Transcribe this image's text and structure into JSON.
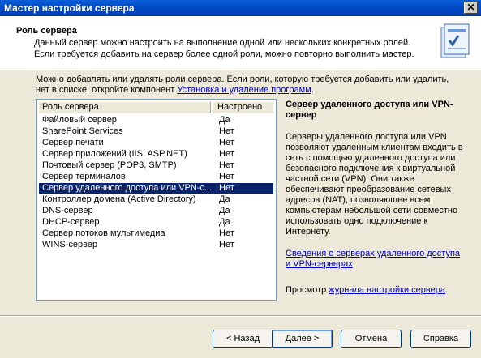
{
  "window": {
    "title": "Мастер настройки сервера",
    "close_label": "✕"
  },
  "header": {
    "title": "Роль сервера",
    "description_line1": "Данный сервер можно настроить на выполнение одной или нескольких конкретных ролей.",
    "description_line2": "Если требуется добавить на сервер более одной роли, можно повторно выполнить мастер.",
    "icon": "server-wizard-icon"
  },
  "intro": {
    "line1": "Можно добавлять или удалять роли сервера. Если роли, которую требуется добавить или удалить,",
    "line2_prefix": "нет в списке, откройте компонент ",
    "link": "Установка и удаление программ",
    "line2_suffix": "."
  },
  "list": {
    "col_role": "Роль сервера",
    "col_configured": "Настроено",
    "rows": [
      {
        "role": "Файловый сервер",
        "configured": "Да"
      },
      {
        "role": "SharePoint Services",
        "configured": "Нет"
      },
      {
        "role": "Сервер печати",
        "configured": "Нет"
      },
      {
        "role": "Сервер приложений (IIS, ASP.NET)",
        "configured": "Нет"
      },
      {
        "role": "Почтовый сервер (POP3, SMTP)",
        "configured": "Нет"
      },
      {
        "role": "Сервер терминалов",
        "configured": "Нет"
      },
      {
        "role": "Сервер удаленного доступа или VPN-с...",
        "configured": "Нет"
      },
      {
        "role": "Контроллер домена (Active Directory)",
        "configured": "Да"
      },
      {
        "role": "DNS-сервер",
        "configured": "Да"
      },
      {
        "role": "DHCP-сервер",
        "configured": "Да"
      },
      {
        "role": "Сервер потоков мультимедиа",
        "configured": "Нет"
      },
      {
        "role": "WINS-сервер",
        "configured": "Нет"
      }
    ]
  },
  "description": {
    "title": "Сервер удаленного доступа или VPN-сервер",
    "body": "Серверы удаленного доступа или VPN позволяют удаленным клиентам входить в сеть с помощью удаленного доступа или безопасного подключения к виртуальной частной сети (VPN). Они также обеспечивают преобразование сетевых адресов (NAT), позволяющее всем компьютерам небольшой сети совместно использовать одно подключение к Интернету.",
    "info_link": "Сведения о серверах удаленного доступа и VPN-серверах",
    "log_prefix": "Просмотр ",
    "log_link": "журнала настройки сервера",
    "log_suffix": "."
  },
  "buttons": {
    "back": "< Назад",
    "next": "Далее >",
    "cancel": "Отмена",
    "help": "Справка"
  }
}
